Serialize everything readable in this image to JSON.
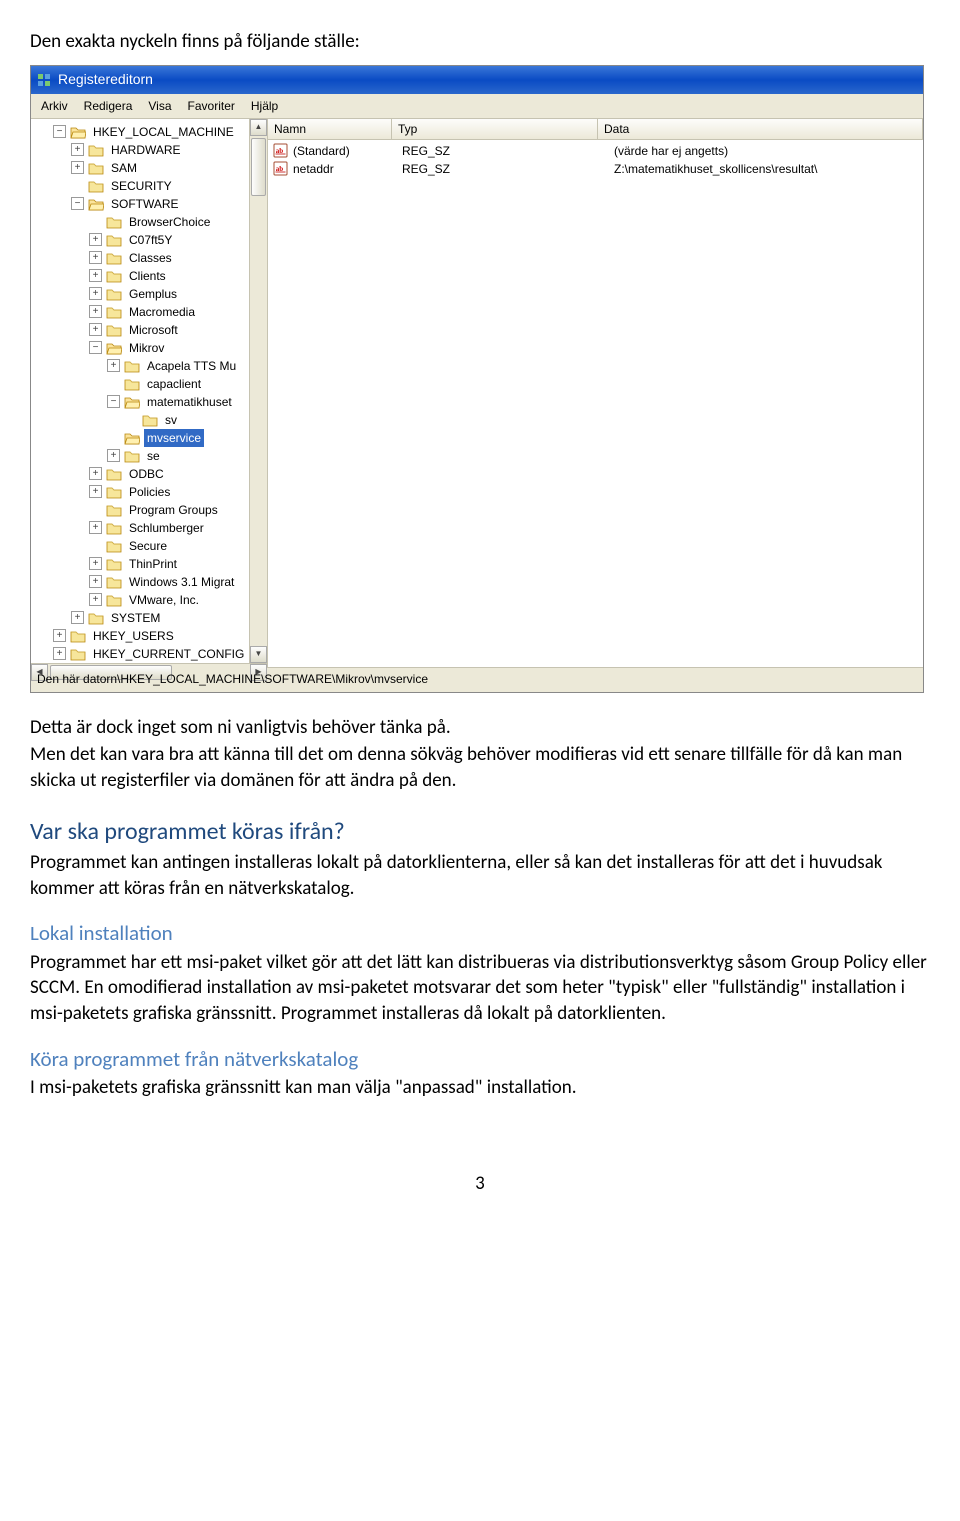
{
  "intro": "Den exakta nyckeln finns på följande ställe:",
  "regedit": {
    "title": "Registereditorn",
    "menu": {
      "file": "Arkiv",
      "edit": "Redigera",
      "view": "Visa",
      "favorites": "Favoriter",
      "help": "Hjälp"
    },
    "columns": {
      "name": "Namn",
      "type": "Typ",
      "data": "Data"
    },
    "values": [
      {
        "name": "(Standard)",
        "type": "REG_SZ",
        "data": "(värde har ej angetts)"
      },
      {
        "name": "netaddr",
        "type": "REG_SZ",
        "data": "Z:\\matematikhuset_skollicens\\resultat\\"
      }
    ],
    "statusbar": "Den här datorn\\HKEY_LOCAL_MACHINE\\SOFTWARE\\Mikrov\\mvservice",
    "tree": {
      "hklm": "HKEY_LOCAL_MACHINE",
      "hardware": "HARDWARE",
      "sam": "SAM",
      "security": "SECURITY",
      "software": "SOFTWARE",
      "browserchoice": "BrowserChoice",
      "c07ft5y": "C07ft5Y",
      "classes": "Classes",
      "clients": "Clients",
      "gemplus": "Gemplus",
      "macromedia": "Macromedia",
      "microsoft": "Microsoft",
      "mikrov": "Mikrov",
      "acapela": "Acapela TTS Mu",
      "capaclient": "capaclient",
      "matematikhuset": "matematikhuset",
      "sv": "sv",
      "mvservice": "mvservice",
      "se": "se",
      "odbc": "ODBC",
      "policies": "Policies",
      "programgroups": "Program Groups",
      "schlumberger": "Schlumberger",
      "secure": "Secure",
      "thinprint": "ThinPrint",
      "win31": "Windows 3.1 Migrat",
      "vmware": "VMware, Inc.",
      "system": "SYSTEM",
      "hku": "HKEY_USERS",
      "hkcc": "HKEY_CURRENT_CONFIG"
    }
  },
  "para1_a": "Detta är dock inget som ni vanligtvis behöver tänka på.",
  "para1_b": "Men det kan vara bra att känna till det om denna sökväg behöver modifieras vid ett senare tillfälle för då kan man skicka ut registerfiler via domänen för att ändra på den.",
  "h_var": "Var ska programmet köras ifrån?",
  "para2": "Programmet kan antingen installeras lokalt på datorklienterna, eller så kan det installeras för att det i huvudsak kommer att köras från en nätverkskatalog.",
  "h_lokal": "Lokal installation",
  "para3": "Programmet har ett msi-paket vilket gör att det lätt kan distribueras via distributionsverktyg såsom Group Policy eller SCCM. En omodifierad installation av msi-paketet motsvarar det som heter \"typisk\" eller \"fullständig\" installation i msi-paketets grafiska gränssnitt. Programmet installeras då lokalt på datorklienten.",
  "h_net": "Köra programmet från nätverkskatalog",
  "para4": "I msi-paketets grafiska gränssnitt kan man välja \"anpassad\" installation.",
  "pagenum": "3"
}
